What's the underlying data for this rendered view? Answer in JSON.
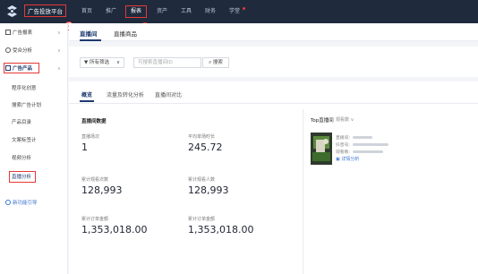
{
  "header": {
    "app_title": "广告投放平台",
    "nav": [
      "首页",
      "推广",
      "报表",
      "资产",
      "工具",
      "财务",
      "学堂"
    ],
    "active_index": 2
  },
  "annotations": [
    "1",
    "2",
    "3",
    "4"
  ],
  "sidebar": {
    "groups": [
      {
        "label": "广告报表",
        "icon": "report-icon"
      },
      {
        "label": "受众分析",
        "icon": "audience-icon"
      },
      {
        "label": "广告产品",
        "icon": "product-icon"
      }
    ],
    "sub_items": [
      "程序化创意",
      "搜索广告计划",
      "产品目录",
      "文案标签计",
      "视频分析",
      "直播分析"
    ],
    "active_sub": "直播分析",
    "footer_link": "新功能引导"
  },
  "content_tabs": [
    "直播间",
    "直播商品"
  ],
  "filters": {
    "select_value": "所有筛选",
    "search_placeholder": "可搜索直播间ID",
    "search_button": "搜索"
  },
  "metric_tabs": [
    "概览",
    "流量及转化分析",
    "直播间对比"
  ],
  "overview": {
    "section_title": "直播间数据",
    "metrics": [
      {
        "label": "直播场次",
        "value": "1"
      },
      {
        "label": "平均单场时长",
        "value": "245.72"
      },
      {
        "label": "累计观看次数",
        "value": "128,993"
      },
      {
        "label": "累计观看人数",
        "value": "128,993"
      },
      {
        "label": "累计订单金额",
        "value": "1,353,018.00"
      },
      {
        "label": "累计订单金额",
        "value": "1,353,018.00"
      }
    ]
  },
  "top_panel": {
    "title": "Top直播间",
    "select_label": "观看数",
    "row1_label": "直播间:",
    "row2_label": "抖音号:",
    "row3_label": "观看数:",
    "link_label": "详情分析"
  },
  "colors": {
    "topbar": "#1f2a3d",
    "accent_red": "#e53935",
    "brand_blue": "#1f3b70",
    "link_blue": "#3a73d0"
  }
}
